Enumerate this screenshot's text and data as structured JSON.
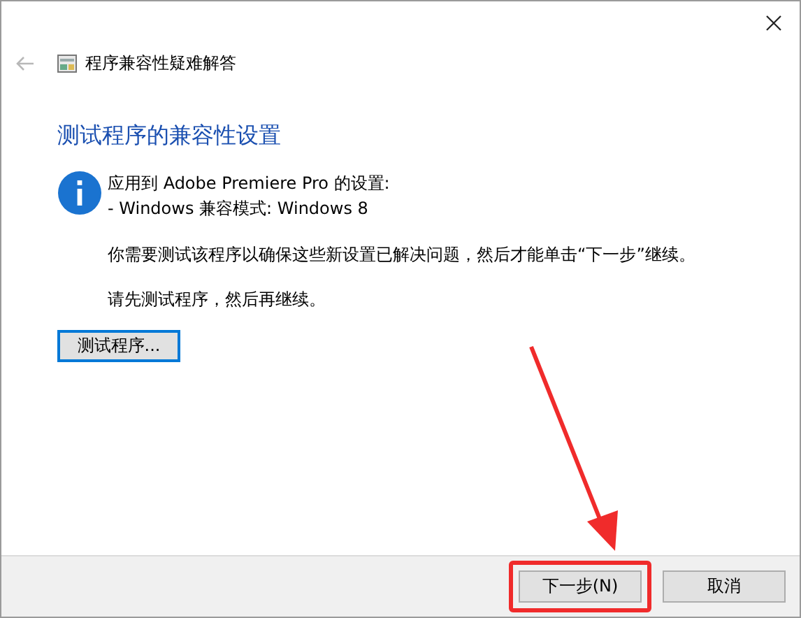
{
  "header": {
    "back_disabled": true,
    "title": "程序兼容性疑难解答"
  },
  "heading": "测试程序的兼容性设置",
  "info_lines": [
    "应用到 Adobe Premiere Pro 的设置:",
    "- Windows 兼容模式: Windows 8"
  ],
  "paragraphs": [
    "你需要测试该程序以确保这些新设置已解决问题，然后才能单击“下一步”继续。",
    "请先测试程序，然后再继续。"
  ],
  "test_button": {
    "label": "测试程序...",
    "focused": true
  },
  "footer_buttons": [
    {
      "label": "下一步(N)",
      "highlighted": true
    },
    {
      "label": "取消",
      "highlighted": false
    }
  ]
}
